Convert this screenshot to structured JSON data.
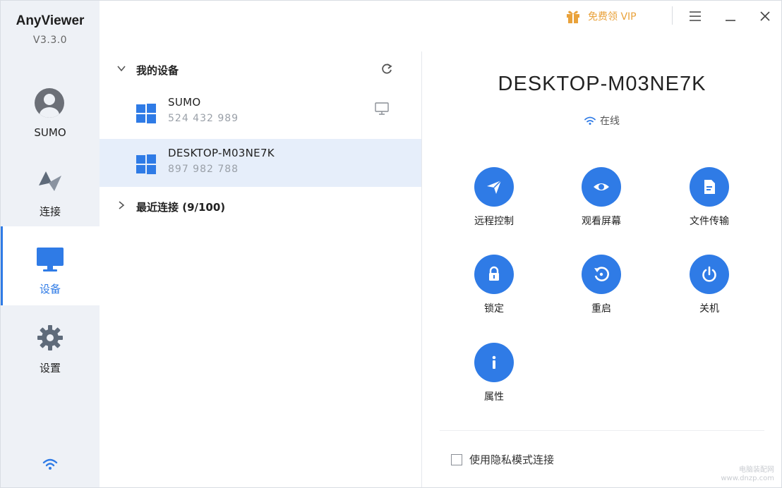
{
  "app": {
    "name": "AnyViewer",
    "version": "V3.3.0"
  },
  "titlebar": {
    "vip_label": "免费领 VIP",
    "icons": [
      "gift-icon",
      "menu-icon",
      "minimize-icon",
      "close-icon"
    ]
  },
  "sidebar": {
    "items": [
      {
        "label": "SUMO",
        "icon": "avatar-icon",
        "active": false
      },
      {
        "label": "连接",
        "icon": "connect-icon",
        "active": false
      },
      {
        "label": "设备",
        "icon": "monitor-icon",
        "active": true
      },
      {
        "label": "设置",
        "icon": "gear-icon",
        "active": false
      }
    ],
    "footer_icon": "wifi-icon"
  },
  "devices": {
    "my_devices_label": "我的设备",
    "items": [
      {
        "name": "SUMO",
        "id": "524 432 989",
        "selected": false
      },
      {
        "name": "DESKTOP-M03NE7K",
        "id": "897 982 788",
        "selected": true
      }
    ],
    "recent_label": "最近连接 (9/100)"
  },
  "detail": {
    "device_name": "DESKTOP-M03NE7K",
    "status": "在线",
    "actions": [
      {
        "label": "远程控制",
        "icon": "send-icon"
      },
      {
        "label": "观看屏幕",
        "icon": "eye-icon"
      },
      {
        "label": "文件传输",
        "icon": "file-icon"
      },
      {
        "label": "锁定",
        "icon": "lock-icon"
      },
      {
        "label": "重启",
        "icon": "restart-icon"
      },
      {
        "label": "关机",
        "icon": "power-icon"
      },
      {
        "label": "属性",
        "icon": "info-icon"
      }
    ],
    "privacy_label": "使用隐私模式连接"
  },
  "colors": {
    "accent": "#2f7be6",
    "vip": "#e9a23b",
    "sidebar_bg": "#eef1f6",
    "selected_bg": "#e6eefa"
  },
  "watermark": {
    "line1": "电脑装配网",
    "line2": "www.dnzp.com"
  }
}
